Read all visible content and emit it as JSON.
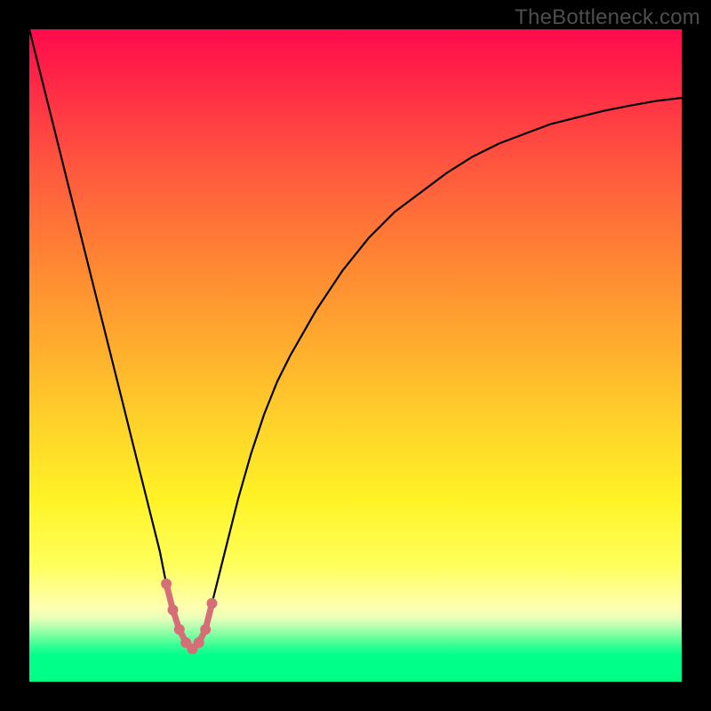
{
  "watermark": "TheBottleneck.com",
  "colors": {
    "frame": "#000000",
    "curve": "#000000",
    "marker": "#d66d77",
    "gradient_top": "#ff0a4c",
    "gradient_bottom": "#00ff84"
  },
  "chart_data": {
    "type": "line",
    "title": "",
    "xlabel": "",
    "ylabel": "",
    "xlim": [
      0,
      100
    ],
    "ylim": [
      0,
      100
    ],
    "x": [
      0,
      2,
      4,
      6,
      8,
      10,
      12,
      14,
      16,
      18,
      20,
      21,
      22,
      23,
      24,
      25,
      26,
      27,
      28,
      30,
      32,
      34,
      36,
      38,
      40,
      44,
      48,
      52,
      56,
      60,
      64,
      68,
      72,
      76,
      80,
      84,
      88,
      92,
      96,
      100
    ],
    "series": [
      {
        "name": "bottleneck_curve",
        "values": [
          100,
          92,
          84,
          76,
          68,
          60,
          52,
          44,
          36,
          28,
          20,
          15,
          11,
          8,
          6,
          5,
          6,
          8,
          12,
          20,
          28,
          35,
          41,
          46,
          50,
          57,
          63,
          68,
          72,
          75,
          78,
          80.5,
          82.5,
          84,
          85.5,
          86.5,
          87.5,
          88.3,
          89,
          89.5
        ]
      }
    ],
    "highlight_range_x": [
      21,
      29
    ],
    "annotations": []
  }
}
